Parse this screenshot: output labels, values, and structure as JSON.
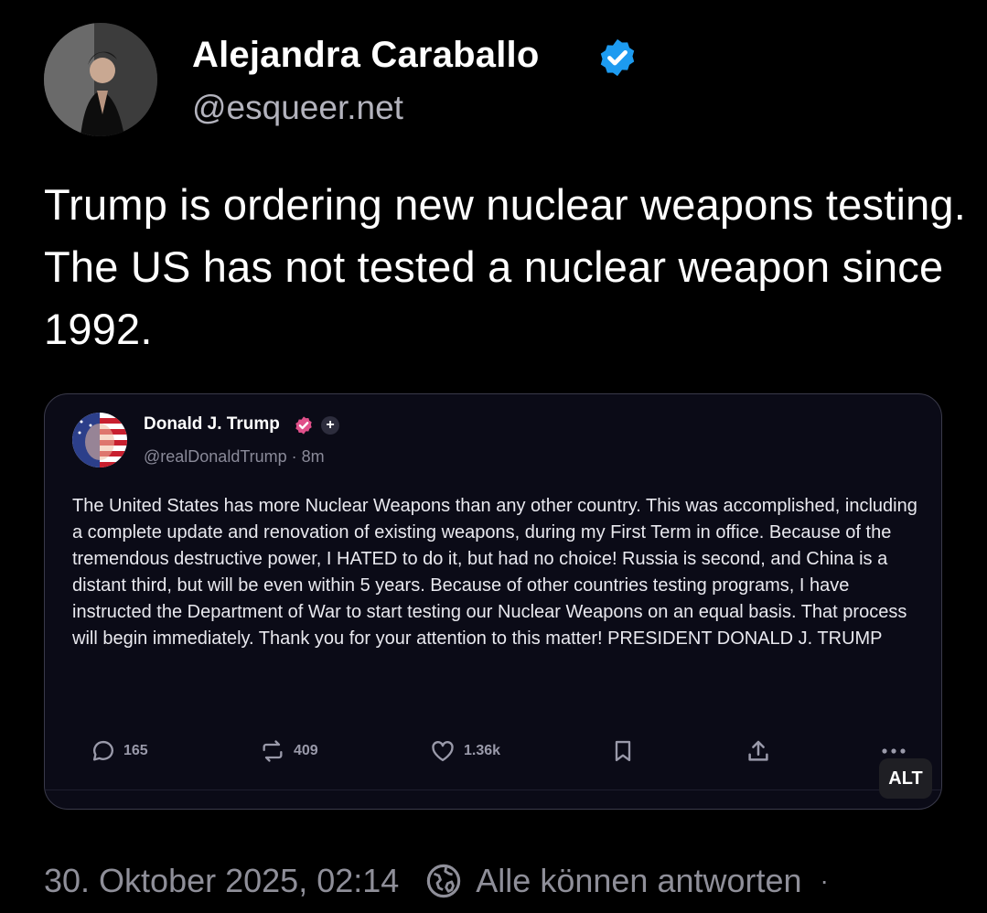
{
  "author": {
    "name": "Alejandra Caraballo",
    "handle": "@esqueer.net",
    "verified": true
  },
  "post": {
    "text": "Trump is ordering new nuclear weapons testing. The US has not tested a nuclear weapon since 1992."
  },
  "quoted_post": {
    "name": "Donald J. Trump",
    "handle_time": "@realDonaldTrump · 8m",
    "body": "The United States has more Nuclear Weapons than any other country. This was accomplished, including a complete update and renovation of existing weapons, during my First Term in office. Because of the tremendous destructive power, I HATED to do it, but had no choice! Russia is second, and China is a distant third, but will be even within 5 years. Because of other countries testing programs, I have instructed the Department of War to start testing our Nuclear Weapons on an equal basis. That process will begin immediately. Thank you for your attention to this matter! PRESIDENT DONALD J. TRUMP",
    "actions": {
      "replies": "165",
      "reposts": "409",
      "likes": "1.36k"
    },
    "alt_label": "ALT"
  },
  "footer": {
    "timestamp": "30. Oktober 2025, 02:14",
    "reply_setting": "Alle können antworten",
    "separator": "·"
  },
  "colors": {
    "background": "#000000",
    "verified_blue": "#1d9bf0",
    "quote_badge_pink": "#e0508a",
    "muted_text": "#8f8f99"
  },
  "icons": [
    "verified-icon",
    "reply-icon",
    "repost-icon",
    "like-icon",
    "bookmark-icon",
    "share-icon",
    "more-icon",
    "globe-reply-icon",
    "plus-icon"
  ]
}
